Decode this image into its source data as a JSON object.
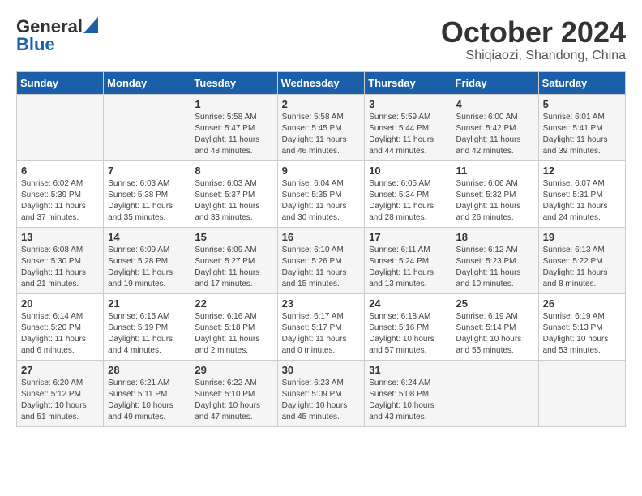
{
  "header": {
    "logo": {
      "general": "General",
      "blue": "Blue"
    },
    "month": "October 2024",
    "location": "Shiqiaozi, Shandong, China"
  },
  "weekdays": [
    "Sunday",
    "Monday",
    "Tuesday",
    "Wednesday",
    "Thursday",
    "Friday",
    "Saturday"
  ],
  "weeks": [
    [
      {
        "day": null
      },
      {
        "day": null
      },
      {
        "day": "1",
        "sunrise": "Sunrise: 5:58 AM",
        "sunset": "Sunset: 5:47 PM",
        "daylight": "Daylight: 11 hours and 48 minutes."
      },
      {
        "day": "2",
        "sunrise": "Sunrise: 5:58 AM",
        "sunset": "Sunset: 5:45 PM",
        "daylight": "Daylight: 11 hours and 46 minutes."
      },
      {
        "day": "3",
        "sunrise": "Sunrise: 5:59 AM",
        "sunset": "Sunset: 5:44 PM",
        "daylight": "Daylight: 11 hours and 44 minutes."
      },
      {
        "day": "4",
        "sunrise": "Sunrise: 6:00 AM",
        "sunset": "Sunset: 5:42 PM",
        "daylight": "Daylight: 11 hours and 42 minutes."
      },
      {
        "day": "5",
        "sunrise": "Sunrise: 6:01 AM",
        "sunset": "Sunset: 5:41 PM",
        "daylight": "Daylight: 11 hours and 39 minutes."
      }
    ],
    [
      {
        "day": "6",
        "sunrise": "Sunrise: 6:02 AM",
        "sunset": "Sunset: 5:39 PM",
        "daylight": "Daylight: 11 hours and 37 minutes."
      },
      {
        "day": "7",
        "sunrise": "Sunrise: 6:03 AM",
        "sunset": "Sunset: 5:38 PM",
        "daylight": "Daylight: 11 hours and 35 minutes."
      },
      {
        "day": "8",
        "sunrise": "Sunrise: 6:03 AM",
        "sunset": "Sunset: 5:37 PM",
        "daylight": "Daylight: 11 hours and 33 minutes."
      },
      {
        "day": "9",
        "sunrise": "Sunrise: 6:04 AM",
        "sunset": "Sunset: 5:35 PM",
        "daylight": "Daylight: 11 hours and 30 minutes."
      },
      {
        "day": "10",
        "sunrise": "Sunrise: 6:05 AM",
        "sunset": "Sunset: 5:34 PM",
        "daylight": "Daylight: 11 hours and 28 minutes."
      },
      {
        "day": "11",
        "sunrise": "Sunrise: 6:06 AM",
        "sunset": "Sunset: 5:32 PM",
        "daylight": "Daylight: 11 hours and 26 minutes."
      },
      {
        "day": "12",
        "sunrise": "Sunrise: 6:07 AM",
        "sunset": "Sunset: 5:31 PM",
        "daylight": "Daylight: 11 hours and 24 minutes."
      }
    ],
    [
      {
        "day": "13",
        "sunrise": "Sunrise: 6:08 AM",
        "sunset": "Sunset: 5:30 PM",
        "daylight": "Daylight: 11 hours and 21 minutes."
      },
      {
        "day": "14",
        "sunrise": "Sunrise: 6:09 AM",
        "sunset": "Sunset: 5:28 PM",
        "daylight": "Daylight: 11 hours and 19 minutes."
      },
      {
        "day": "15",
        "sunrise": "Sunrise: 6:09 AM",
        "sunset": "Sunset: 5:27 PM",
        "daylight": "Daylight: 11 hours and 17 minutes."
      },
      {
        "day": "16",
        "sunrise": "Sunrise: 6:10 AM",
        "sunset": "Sunset: 5:26 PM",
        "daylight": "Daylight: 11 hours and 15 minutes."
      },
      {
        "day": "17",
        "sunrise": "Sunrise: 6:11 AM",
        "sunset": "Sunset: 5:24 PM",
        "daylight": "Daylight: 11 hours and 13 minutes."
      },
      {
        "day": "18",
        "sunrise": "Sunrise: 6:12 AM",
        "sunset": "Sunset: 5:23 PM",
        "daylight": "Daylight: 11 hours and 10 minutes."
      },
      {
        "day": "19",
        "sunrise": "Sunrise: 6:13 AM",
        "sunset": "Sunset: 5:22 PM",
        "daylight": "Daylight: 11 hours and 8 minutes."
      }
    ],
    [
      {
        "day": "20",
        "sunrise": "Sunrise: 6:14 AM",
        "sunset": "Sunset: 5:20 PM",
        "daylight": "Daylight: 11 hours and 6 minutes."
      },
      {
        "day": "21",
        "sunrise": "Sunrise: 6:15 AM",
        "sunset": "Sunset: 5:19 PM",
        "daylight": "Daylight: 11 hours and 4 minutes."
      },
      {
        "day": "22",
        "sunrise": "Sunrise: 6:16 AM",
        "sunset": "Sunset: 5:18 PM",
        "daylight": "Daylight: 11 hours and 2 minutes."
      },
      {
        "day": "23",
        "sunrise": "Sunrise: 6:17 AM",
        "sunset": "Sunset: 5:17 PM",
        "daylight": "Daylight: 11 hours and 0 minutes."
      },
      {
        "day": "24",
        "sunrise": "Sunrise: 6:18 AM",
        "sunset": "Sunset: 5:16 PM",
        "daylight": "Daylight: 10 hours and 57 minutes."
      },
      {
        "day": "25",
        "sunrise": "Sunrise: 6:19 AM",
        "sunset": "Sunset: 5:14 PM",
        "daylight": "Daylight: 10 hours and 55 minutes."
      },
      {
        "day": "26",
        "sunrise": "Sunrise: 6:19 AM",
        "sunset": "Sunset: 5:13 PM",
        "daylight": "Daylight: 10 hours and 53 minutes."
      }
    ],
    [
      {
        "day": "27",
        "sunrise": "Sunrise: 6:20 AM",
        "sunset": "Sunset: 5:12 PM",
        "daylight": "Daylight: 10 hours and 51 minutes."
      },
      {
        "day": "28",
        "sunrise": "Sunrise: 6:21 AM",
        "sunset": "Sunset: 5:11 PM",
        "daylight": "Daylight: 10 hours and 49 minutes."
      },
      {
        "day": "29",
        "sunrise": "Sunrise: 6:22 AM",
        "sunset": "Sunset: 5:10 PM",
        "daylight": "Daylight: 10 hours and 47 minutes."
      },
      {
        "day": "30",
        "sunrise": "Sunrise: 6:23 AM",
        "sunset": "Sunset: 5:09 PM",
        "daylight": "Daylight: 10 hours and 45 minutes."
      },
      {
        "day": "31",
        "sunrise": "Sunrise: 6:24 AM",
        "sunset": "Sunset: 5:08 PM",
        "daylight": "Daylight: 10 hours and 43 minutes."
      },
      {
        "day": null
      },
      {
        "day": null
      }
    ]
  ]
}
